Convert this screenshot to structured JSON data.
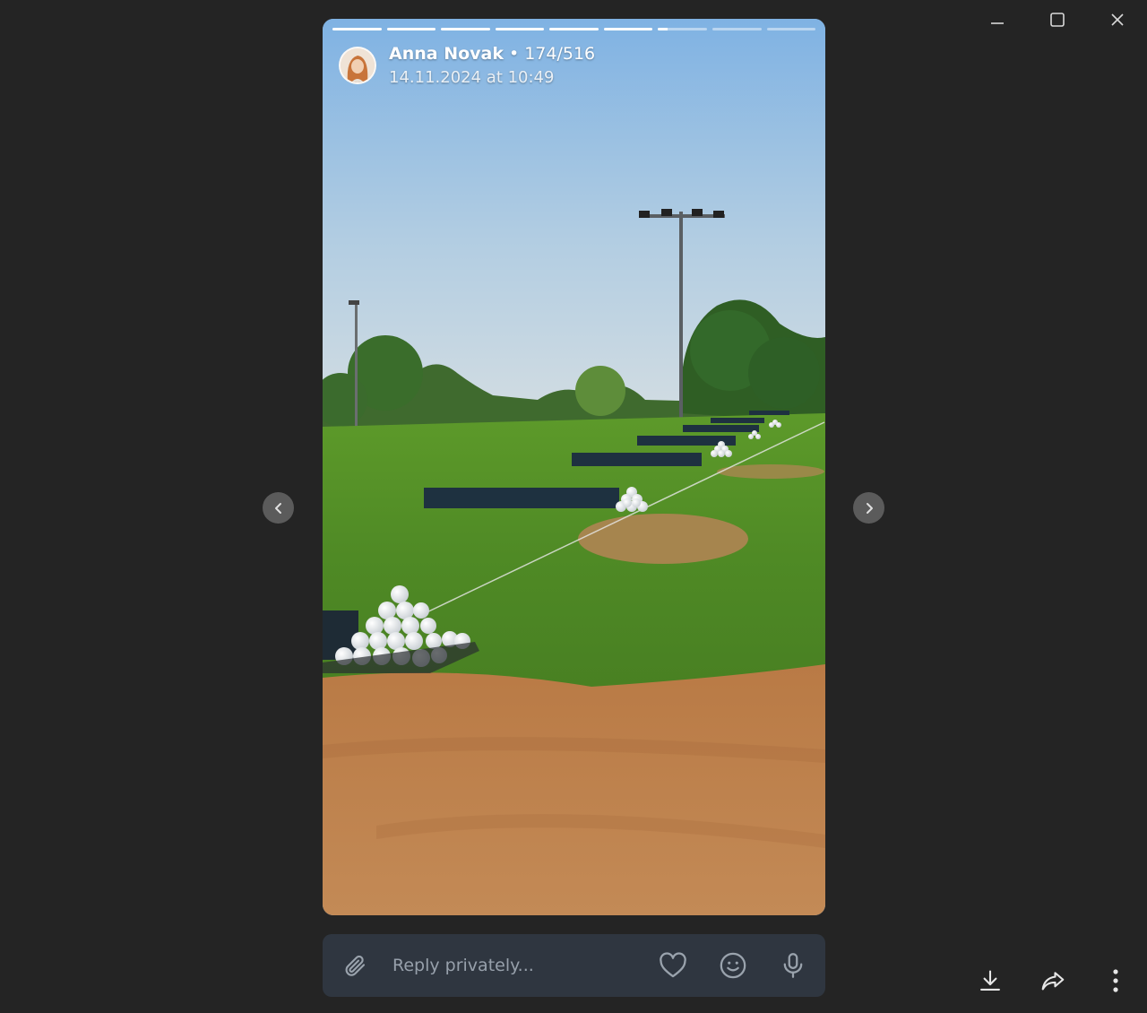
{
  "window": {
    "controls": [
      "minimize-icon",
      "maximize-icon",
      "close-icon"
    ]
  },
  "story": {
    "author": "Anna Novak",
    "separator": "•",
    "counter": "174/516",
    "date": "14.11.2024 at 10:49",
    "progress_segments": [
      1,
      1,
      1,
      1,
      1,
      1,
      0.2,
      0,
      0
    ],
    "image_description_icons": [
      "golf-range-photo"
    ]
  },
  "navigation": {
    "prev_icon": "chevron-left-icon",
    "next_icon": "chevron-right-icon"
  },
  "reply": {
    "placeholder": "Reply privately..."
  },
  "colors": {
    "background": "#242424",
    "reply_bar": "#2f3640",
    "nav_button": "#5b5b5b"
  }
}
